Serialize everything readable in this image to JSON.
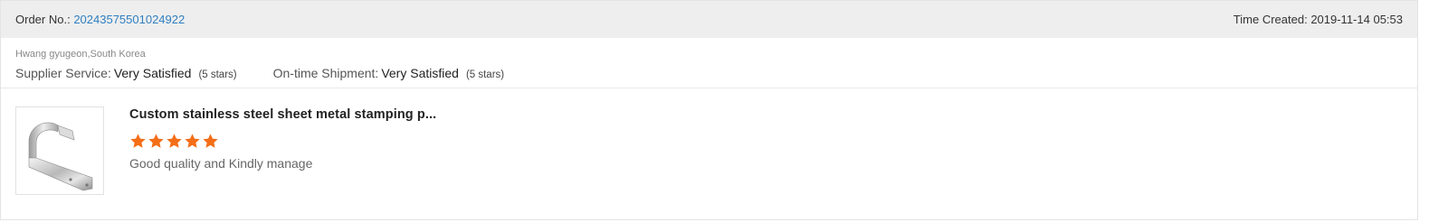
{
  "header": {
    "order_label": "Order No.:",
    "order_number": "20243575501024922",
    "time_label": "Time Created:",
    "time_value": "2019-11-14 05:53"
  },
  "buyer": {
    "location": "Hwang gyugeon,South Korea"
  },
  "ratings": [
    {
      "label": "Supplier Service:",
      "value": "Very Satisfied",
      "stars_text": "(5 stars)"
    },
    {
      "label": "On-time Shipment:",
      "value": "Very Satisfied",
      "stars_text": "(5 stars)"
    }
  ],
  "review": {
    "product_title": "Custom stainless steel sheet metal stamping p...",
    "star_rating": 5,
    "star_color": "#f46e18",
    "comment": "Good quality and Kindly manage",
    "thumbnail_icon": "metal-bracket-image"
  },
  "colors": {
    "link": "#2f7fc1",
    "header_bg": "#eeeeee"
  }
}
